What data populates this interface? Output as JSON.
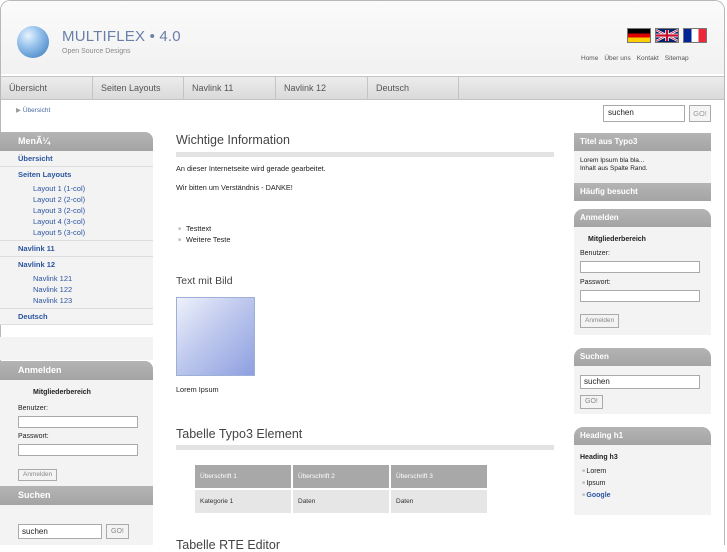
{
  "header": {
    "brand": "MULTIFLEX • 4.0",
    "tagline": "Open Source Designs",
    "flags": [
      "flag-de-icon",
      "flag-gb-icon",
      "flag-fr-icon"
    ],
    "toplinks": [
      "Home",
      "Über uns",
      "Kontakt",
      "Sitemap"
    ]
  },
  "nav": {
    "items": [
      "Übersicht",
      "Seiten Layouts",
      "Navlink 11",
      "Navlink 12",
      "Deutsch"
    ]
  },
  "breadcrumb": "Übersicht",
  "search_top": {
    "value": "suchen",
    "button": "GO!"
  },
  "left_menu": {
    "title": "MenÃ¼",
    "items": [
      {
        "label": "Übersicht",
        "level": 1
      },
      {
        "label": "Seiten Layouts",
        "level": 1
      },
      {
        "label": "Layout 1 (1-col)",
        "level": 2
      },
      {
        "label": "Layout 2 (2-col)",
        "level": 2
      },
      {
        "label": "Layout 3 (2-col)",
        "level": 2
      },
      {
        "label": "Layout 4 (3-col)",
        "level": 2
      },
      {
        "label": "Layout 5 (3-col)",
        "level": 2
      },
      {
        "label": "Navlink 11",
        "level": 1
      },
      {
        "label": "Navlink 12",
        "level": 1
      },
      {
        "label": "Navlink 121",
        "level": 2
      },
      {
        "label": "Navlink 122",
        "level": 2
      },
      {
        "label": "Navlink 123",
        "level": 2
      },
      {
        "label": "Deutsch",
        "level": 1
      }
    ]
  },
  "left_login": {
    "title": "Anmelden",
    "subtitle": "Mitgliederbereich",
    "user_label": "Benutzer:",
    "pass_label": "Passwort:",
    "button": "Anmelden"
  },
  "left_search": {
    "title": "Suchen",
    "value": "suchen",
    "button": "GO!"
  },
  "main": {
    "h1": "Wichtige Information",
    "p1": "An dieser Internetseite wird gerade gearbeitet.",
    "p2": "Wir bitten um  Verständnis - DANKE!",
    "bullets": [
      "Testtext",
      "Weitere Teste"
    ],
    "h2": "Text mit Bild",
    "caption": "Lorem Ipsum",
    "h3": "Tabelle Typo3 Element",
    "table_headers": [
      "Überschrift 1",
      "Überschrift 2",
      "Überschrift 3"
    ],
    "table_row": [
      "Kategorie 1",
      "Daten",
      "Daten"
    ],
    "h4": "Tabelle RTE Editor"
  },
  "right": {
    "box1_title": "Titel aus Typo3",
    "box1_line1": "Lorem Ipsum bla bla...",
    "box1_line2": "Inhalt aus Spalte Rand.",
    "box2_title": "Häufig besucht",
    "login_title": "Anmelden",
    "login_subtitle": "Mitgliederbereich",
    "user_label": "Benutzer:",
    "pass_label": "Passwort:",
    "login_button": "Anmelden",
    "search_title": "Suchen",
    "search_value": "suchen",
    "search_button": "GO!",
    "heading_title": "Heading h1",
    "heading_sub": "Heading h3",
    "heading_items": [
      "Lorem",
      "Ipsum",
      "Google"
    ]
  }
}
